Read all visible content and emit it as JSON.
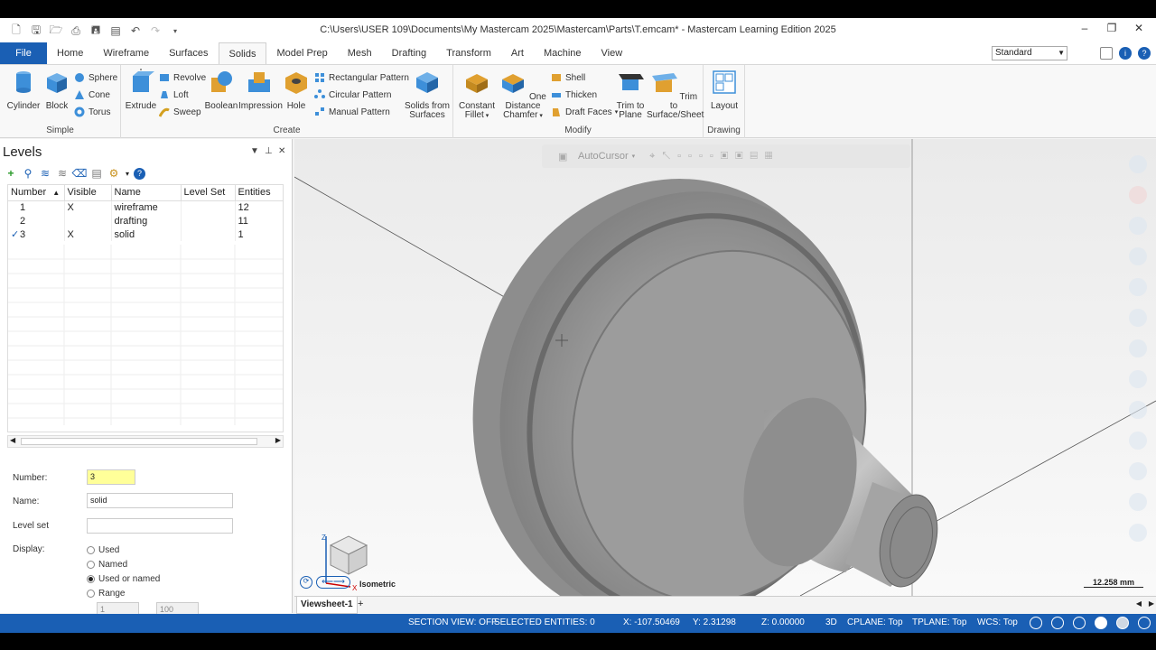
{
  "titlebar": {
    "title": "C:\\Users\\USER 109\\Documents\\My Mastercam 2025\\Mastercam\\Parts\\T.emcam* - Mastercam Learning Edition 2025",
    "minimize": "–",
    "restore": "❐",
    "close": "✕"
  },
  "tabs": [
    "File",
    "Home",
    "Wireframe",
    "Surfaces",
    "Solids",
    "Model Prep",
    "Mesh",
    "Drafting",
    "Transform",
    "Art",
    "Machine",
    "View"
  ],
  "active_tab": "Solids",
  "config_select": "Standard",
  "ribbon": {
    "simple": {
      "label": "Simple",
      "cylinder": "Cylinder",
      "block": "Block",
      "sphere": "Sphere",
      "cone": "Cone",
      "torus": "Torus"
    },
    "create": {
      "label": "Create",
      "extrude": "Extrude",
      "revolve": "Revolve",
      "loft": "Loft",
      "sweep": "Sweep",
      "boolean": "Boolean",
      "impression": "Impression",
      "hole": "Hole",
      "rect_pattern": "Rectangular Pattern",
      "circ_pattern": "Circular Pattern",
      "manual_pattern": "Manual Pattern",
      "solids_from_surfaces_1": "Solids from",
      "solids_from_surfaces_2": "Surfaces"
    },
    "modify": {
      "label": "Modify",
      "fillet_1": "Constant",
      "fillet_2": "Fillet",
      "chamfer_1": "One Distance",
      "chamfer_2": "Chamfer",
      "shell": "Shell",
      "thicken": "Thicken",
      "draft_faces": "Draft Faces",
      "trim_plane_1": "Trim to",
      "trim_plane_2": "Plane",
      "trim_surface_1": "Trim to",
      "trim_surface_2": "Surface/Sheet"
    },
    "drawing": {
      "label": "Drawing",
      "layout": "Layout"
    }
  },
  "levels": {
    "title": "Levels",
    "columns": [
      "Number",
      "Visible",
      "Name",
      "Level Set",
      "Entities"
    ],
    "rows": [
      {
        "check": "",
        "number": "1",
        "visible": "X",
        "name": "wireframe",
        "level_set": "",
        "entities": "12"
      },
      {
        "check": "",
        "number": "2",
        "visible": "",
        "name": "drafting",
        "level_set": "",
        "entities": "11"
      },
      {
        "check": "✓",
        "number": "3",
        "visible": "X",
        "name": "solid",
        "level_set": "",
        "entities": "1"
      }
    ],
    "form": {
      "number_label": "Number:",
      "number_value": "3",
      "name_label": "Name:",
      "name_value": "solid",
      "levelset_label": "Level set",
      "levelset_value": "",
      "display_label": "Display:",
      "opt_used": "Used",
      "opt_named": "Named",
      "opt_used_or_named": "Used or named",
      "opt_range": "Range",
      "range_from": "1",
      "range_to": "100"
    }
  },
  "viewport": {
    "autocursor": "AutoCursor",
    "view_name": "Isometric",
    "scale": "12.258 mm",
    "sheet": "Viewsheet-1",
    "add_sheet": "+"
  },
  "status": {
    "section_view": "SECTION VIEW: OFF",
    "selected": "SELECTED ENTITIES: 0",
    "x": "X:   -107.50469",
    "y": "Y:   2.31298",
    "z": "Z:   0.00000",
    "mode": "3D",
    "cplane": "CPLANE: Top",
    "tplane": "TPLANE: Top",
    "wcs": "WCS: Top"
  },
  "colors": {
    "accent": "#1a5fb4",
    "highlight_input": "#ffff99"
  }
}
